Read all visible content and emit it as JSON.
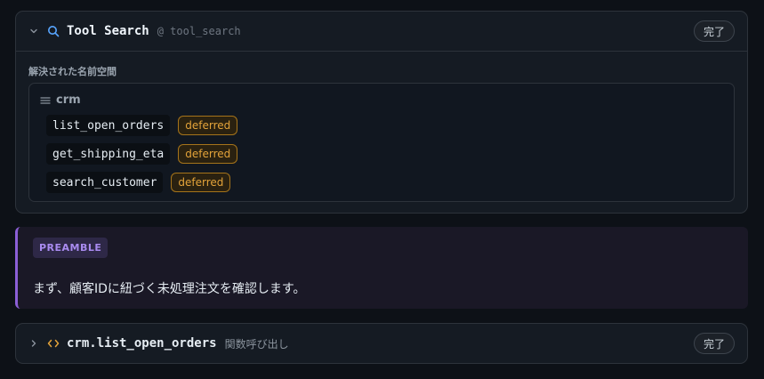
{
  "search_card": {
    "title": "Tool Search",
    "subtitle": "@ tool_search",
    "status": "完了",
    "section_label": "解決された名前空間",
    "namespace": {
      "name": "crm",
      "functions": [
        {
          "name": "list_open_orders",
          "badge": "deferred"
        },
        {
          "name": "get_shipping_eta",
          "badge": "deferred"
        },
        {
          "name": "search_customer",
          "badge": "deferred"
        }
      ]
    }
  },
  "preamble": {
    "tag": "PREAMBLE",
    "text": "まず、顧客IDに紐づく未処理注文を確認します。"
  },
  "call_card": {
    "title": "crm.list_open_orders",
    "subtitle": "関数呼び出し",
    "status": "完了"
  },
  "colors": {
    "background": "#0d1117",
    "card": "#151b23",
    "accent_blue": "#58a6ff",
    "accent_orange": "#e3a33a",
    "accent_purple": "#8b5fd6"
  },
  "icons": {
    "expand_search": "chevron-down-icon",
    "search": "search-icon",
    "namespace": "menu-lines-icon",
    "expand_call": "chevron-right-icon",
    "code": "code-brackets-icon"
  }
}
